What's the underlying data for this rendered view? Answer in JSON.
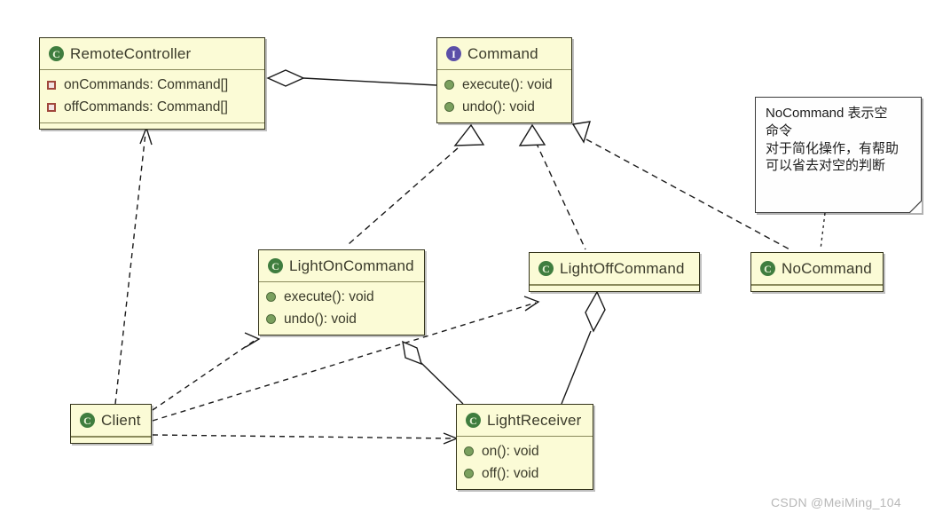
{
  "diagram": {
    "title": "Command Pattern UML Class Diagram",
    "background": "#ffffff",
    "box_fill": "#fbfbd6",
    "box_border": "#33331a",
    "class_icon_color": "#3f7d3f",
    "interface_icon_color": "#5b4fa8",
    "method_icon_color": "#7aa05e",
    "field_icon_color": "#a0473c",
    "line_color": "#1a1a1a"
  },
  "classes": {
    "remote_controller": {
      "name": "RemoteController",
      "icon": "class-icon",
      "members": [
        {
          "icon": "field-icon",
          "label": "onCommands: Command[]"
        },
        {
          "icon": "field-icon",
          "label": "offCommands: Command[]"
        }
      ]
    },
    "command": {
      "name": "Command",
      "icon": "interface-icon",
      "members": [
        {
          "icon": "method-icon",
          "label": "execute(): void"
        },
        {
          "icon": "method-icon",
          "label": "undo(): void"
        }
      ]
    },
    "light_on_command": {
      "name": "LightOnCommand",
      "icon": "class-icon",
      "members": [
        {
          "icon": "method-icon",
          "label": "execute(): void"
        },
        {
          "icon": "method-icon",
          "label": "undo(): void"
        }
      ]
    },
    "light_off_command": {
      "name": "LightOffCommand",
      "icon": "class-icon",
      "members": []
    },
    "no_command": {
      "name": "NoCommand",
      "icon": "class-icon",
      "members": []
    },
    "client": {
      "name": "Client",
      "icon": "class-icon",
      "members": []
    },
    "light_receiver": {
      "name": "LightReceiver",
      "icon": "class-icon",
      "members": [
        {
          "icon": "method-icon",
          "label": "on(): void"
        },
        {
          "icon": "method-icon",
          "label": "off(): void"
        }
      ]
    }
  },
  "note": {
    "lines": [
      "NoCommand 表示空",
      "命令",
      "对于简化操作，有帮助",
      "可以省去对空的判断"
    ]
  },
  "relations": [
    {
      "from": "RemoteController",
      "to": "Command",
      "type": "aggregation"
    },
    {
      "from": "LightOnCommand",
      "to": "Command",
      "type": "realization"
    },
    {
      "from": "LightOffCommand",
      "to": "Command",
      "type": "realization"
    },
    {
      "from": "NoCommand",
      "to": "Command",
      "type": "realization"
    },
    {
      "from": "LightReceiver",
      "to": "LightOnCommand",
      "type": "aggregation"
    },
    {
      "from": "LightReceiver",
      "to": "LightOffCommand",
      "type": "aggregation"
    },
    {
      "from": "Client",
      "to": "RemoteController",
      "type": "dependency"
    },
    {
      "from": "Client",
      "to": "LightOnCommand",
      "type": "dependency"
    },
    {
      "from": "Client",
      "to": "LightOffCommand",
      "type": "dependency"
    },
    {
      "from": "Client",
      "to": "LightReceiver",
      "type": "dependency"
    },
    {
      "from": "Note",
      "to": "NoCommand",
      "type": "note-anchor"
    }
  ],
  "watermark": {
    "text": "CSDN @MeiMing_104"
  }
}
